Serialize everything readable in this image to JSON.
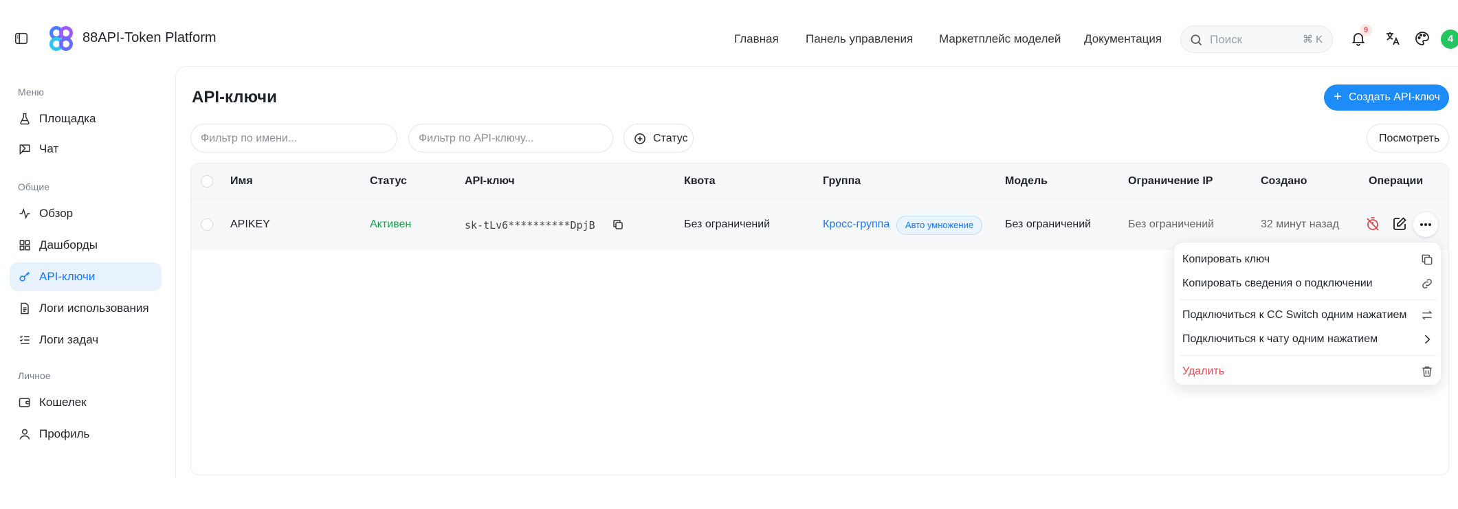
{
  "app": {
    "brand": "88API-Token Platform"
  },
  "nav": [
    "Главная",
    "Панель управления",
    "Маркетплейс моделей",
    "Документация"
  ],
  "search": {
    "placeholder": "Поиск",
    "shortcut": "⌘ K"
  },
  "header": {
    "notification_count": "9",
    "avatar_letter": "4"
  },
  "sidebar": {
    "sections": [
      {
        "label": "Меню",
        "items": [
          {
            "label": "Площадка",
            "icon": "flask-icon"
          },
          {
            "label": "Чат",
            "icon": "chat-icon"
          }
        ]
      },
      {
        "label": "Общие",
        "items": [
          {
            "label": "Обзор",
            "icon": "activity-icon"
          },
          {
            "label": "Дашборды",
            "icon": "grid-icon"
          },
          {
            "label": "API-ключи",
            "icon": "key-icon",
            "active": true
          },
          {
            "label": "Логи использования",
            "icon": "document-icon"
          },
          {
            "label": "Логи задач",
            "icon": "checklist-icon"
          }
        ]
      },
      {
        "label": "Личное",
        "items": [
          {
            "label": "Кошелек",
            "icon": "wallet-icon"
          },
          {
            "label": "Профиль",
            "icon": "user-icon"
          }
        ]
      }
    ]
  },
  "page": {
    "title": "API-ключи",
    "create_label": "Создать API-ключ",
    "filter_name_placeholder": "Фильтр по имени...",
    "filter_key_placeholder": "Фильтр по API-ключу...",
    "status_label": "Статус",
    "view_label": "Посмотреть"
  },
  "table": {
    "columns": [
      "Имя",
      "Статус",
      "API-ключ",
      "Квота",
      "Группа",
      "Модель",
      "Ограничение IP",
      "Создано",
      "Операции"
    ],
    "rows": [
      {
        "name": "APIKEY",
        "status": "Активен",
        "key": "sk-tLv6**********DpjB",
        "quota": "Без ограничений",
        "group": "Кросс-группа",
        "group_tag": "Авто умножение",
        "model": "Без ограничений",
        "ip": "Без ограничений",
        "created": "32 минут назад"
      }
    ]
  },
  "menu": [
    {
      "label": "Копировать ключ",
      "icon": "copy-icon"
    },
    {
      "label": "Копировать сведения о подключении",
      "icon": "link-icon"
    },
    {
      "label": "Подключиться к CC Switch одним нажатием",
      "icon": "swap-icon"
    },
    {
      "label": "Подключиться к чату одним нажатием",
      "icon": "chevron-right-icon"
    },
    {
      "label": "Удалить",
      "icon": "trash-icon",
      "danger": true
    }
  ],
  "colors": {
    "accent": "#1d8cf8",
    "active_bg": "#e8f2fd",
    "success": "#16a34a",
    "danger": "#e5484d"
  }
}
